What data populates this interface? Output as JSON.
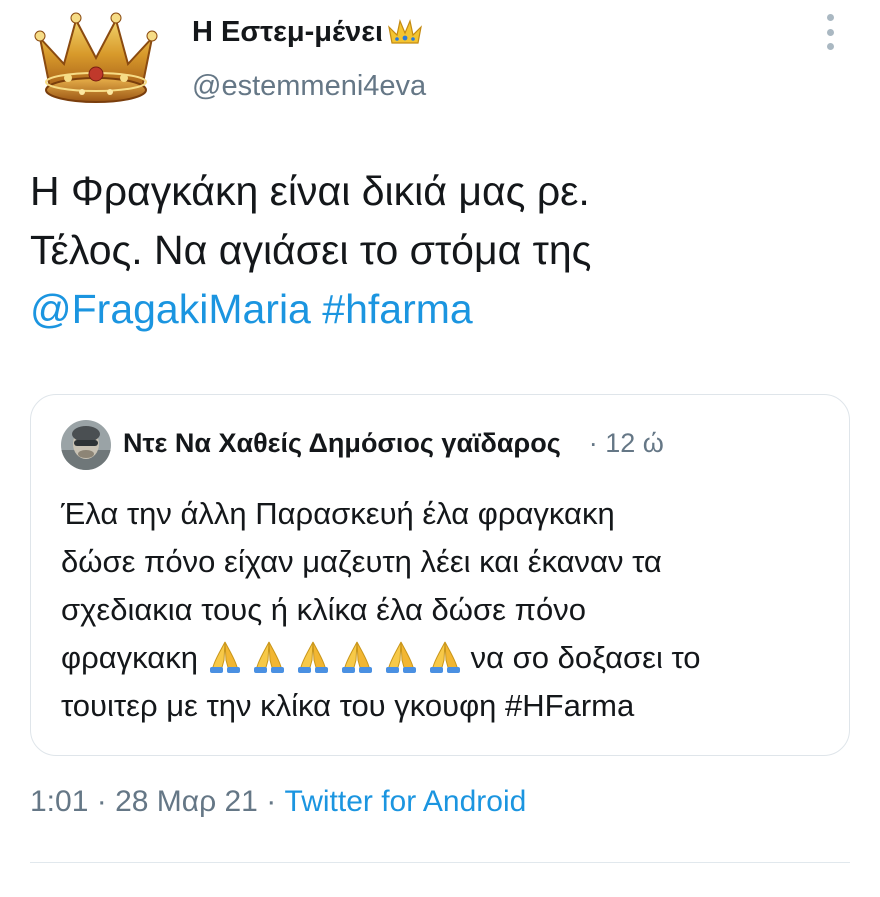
{
  "author": {
    "display_name": "Η Εστεμ-μένει",
    "handle": "@estemmeni4eva"
  },
  "tweet": {
    "text_line1": "Η Φραγκάκη είναι δικιά μας ρε.",
    "text_line2": "Τέλος. Να αγιάσει το στόμα της",
    "mention": "@FragakiMaria",
    "hashtag": "#hfarma"
  },
  "quoted": {
    "name": "Ντε Να Χαθείς Δημόσιος γαϊδαρος",
    "time": "· 12 ώ",
    "line1": "Έλα την άλλη Παρασκευή έλα φραγκακη",
    "line2": "δώσε πόνο είχαν μαζευτη λέει και έκαναν τα",
    "line3": "σχεδιακια τους ή κλίκα έλα δώσε πόνο",
    "line4_prefix": "φραγκακη ",
    "line4_suffix": "να σο δοξασει το",
    "line5": "τουιτερ με την κλίκα του γκουφη #HFarma",
    "emoji_count": 6
  },
  "meta": {
    "time": "1:01",
    "sep1": " · ",
    "date": "28 Μαρ 21",
    "sep2": " · ",
    "source": "Twitter for Android"
  },
  "colors": {
    "link": "#1b95e0",
    "secondary": "#657786",
    "text": "#14171a",
    "border": "#dfe5ea"
  },
  "icons": {
    "author_avatar": "crown-icon",
    "name_emoji": "crown-emoji-icon",
    "more": "more-vertical-icon",
    "quoted_avatar": "user-avatar-icon",
    "prayer_emoji": "folded-hands-icon"
  }
}
